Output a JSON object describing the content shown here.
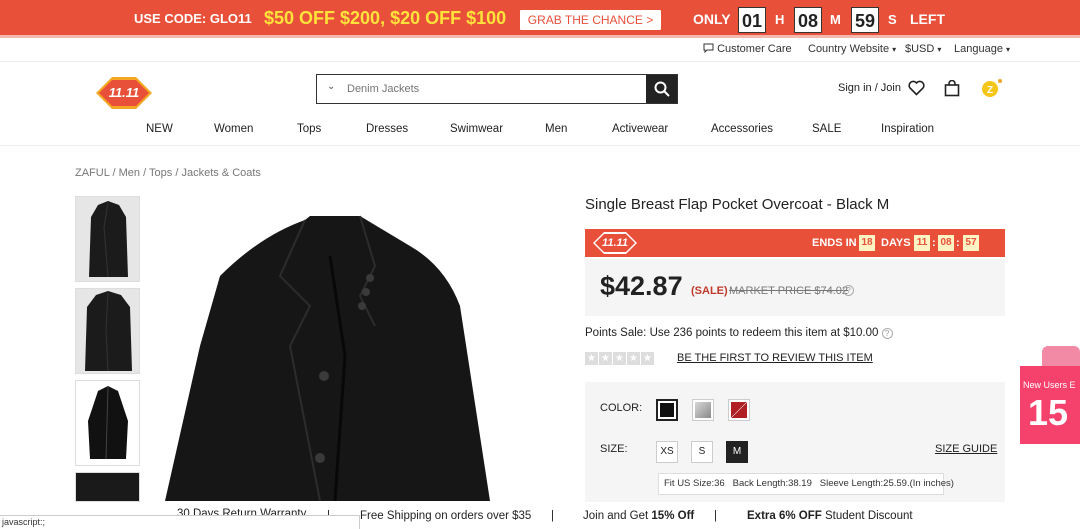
{
  "promo": {
    "code_text": "USE CODE: GLO11",
    "offer_text": "$50 OFF $200, $20 OFF $100",
    "grab_label": "GRAB THE CHANCE >",
    "only_label": "ONLY",
    "hours": "01",
    "h_unit": "H",
    "minutes": "08",
    "m_unit": "M",
    "seconds": "59",
    "s_unit": "S",
    "left_label": "LEFT"
  },
  "utility": {
    "customer_care": "Customer Care",
    "country_website": "Country Website",
    "currency": "$USD",
    "language": "Language"
  },
  "header": {
    "logo_text": "11.11",
    "search_placeholder": "Denim Jackets",
    "signin": "Sign in / Join"
  },
  "nav": [
    "NEW",
    "Women",
    "Tops",
    "Dresses",
    "Swimwear",
    "Men",
    "Activewear",
    "Accessories",
    "SALE",
    "Inspiration"
  ],
  "breadcrumb": {
    "home": "ZAFUL",
    "sep": "/",
    "l1": "Men",
    "l2": "Tops",
    "l3": "Jackets & Coats"
  },
  "product": {
    "title": "Single Breast Flap Pocket Overcoat - Black M",
    "sale_badge": "11.11",
    "ends_in": "ENDS IN",
    "days_value": "18",
    "days_label": "DAYS",
    "hh": "11",
    "mm": "08",
    "ss": "57",
    "colon": ":",
    "price": "$42.87",
    "sale_tag": "(SALE)",
    "market_price": "MARKET PRICE $74.02",
    "points_text": "Points Sale: Use 236 points to redeem this item at $10.00",
    "review_link": "BE THE FIRST TO REVIEW THIS ITEM",
    "color_label": "COLOR:",
    "colors": [
      "#111111",
      "#a8a8a8",
      "#b01f24"
    ],
    "size_label": "SIZE:",
    "sizes": [
      "XS",
      "S",
      "M"
    ],
    "selected_size": "M",
    "size_guide": "SIZE GUIDE",
    "fit_us": "Fit US Size:36",
    "back_length": "Back Length:38.19",
    "sleeve_length": "Sleeve Length:25.59.(In inches)"
  },
  "bottom": {
    "return_warranty": "30 Days Return Warranty",
    "sep": "|",
    "shipping": "Free Shipping on orders over $35",
    "join_prefix": "Join and Get ",
    "join_bold": "15% Off",
    "extra_bold": "Extra 6% OFF",
    "extra_suffix": " Student Discount"
  },
  "new_users": {
    "label": "New Users E",
    "amount": "15"
  },
  "status_bar": "javascript:;"
}
